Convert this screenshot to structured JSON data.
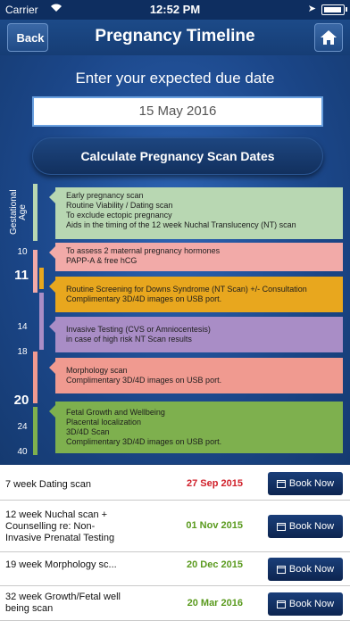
{
  "status": {
    "carrier": "Carrier",
    "time": "12:52 PM"
  },
  "nav": {
    "back_label": "Back",
    "title": "Pregnancy Timeline"
  },
  "form": {
    "prompt": "Enter your expected due date",
    "due_date": "15 May 2016",
    "calc_label": "Calculate Pregnancy Scan Dates"
  },
  "timeline": {
    "axis_label": "Gestational Age",
    "weeks": [
      "10",
      "11",
      "14",
      "18",
      "20",
      "24",
      "40"
    ],
    "boxes": [
      {
        "color": "#b8d7b2",
        "lines": [
          "Early pregnancy scan",
          "Routine Viability / Dating scan",
          "To exclude ectopic pregnancy",
          "Aids in the timing of the 12 week Nuchal Translucency (NT) scan"
        ]
      },
      {
        "color": "#f2aaa8",
        "lines": [
          "To assess 2 maternal pregnancy hormones",
          "PAPP-A & free hCG"
        ]
      },
      {
        "color": "#e8a71e",
        "lines": [
          "Routine Screening for Downs Syndrome (NT Scan) +/- Consultation",
          "Complimentary 3D/4D images on USB port."
        ]
      },
      {
        "color": "#a98dc6",
        "lines": [
          "Invasive Testing (CVS or Amniocentesis)",
          "in case of high risk NT Scan results"
        ]
      },
      {
        "color": "#f09a90",
        "lines": [
          "Morphology scan",
          "Complimentary 3D/4D images on USB port."
        ]
      },
      {
        "color": "#7eb04e",
        "lines": [
          "Fetal Growth and Wellbeing",
          "Placental localization",
          "3D/4D Scan",
          "Complimentary 3D/4D images on USB port."
        ]
      }
    ]
  },
  "bookings": [
    {
      "name": "7 week Dating scan",
      "date": "27 Sep 2015",
      "date_color": "#d0202a",
      "button": "Book Now"
    },
    {
      "name": "12 week Nuchal scan + Counselling re: Non-Invasive Prenatal Testing",
      "date": "01 Nov 2015",
      "date_color": "#5a9a1e",
      "button": "Book Now"
    },
    {
      "name": "19 week Morphology sc...",
      "date": "20 Dec 2015",
      "date_color": "#5a9a1e",
      "button": "Book Now"
    },
    {
      "name": "32 week Growth/Fetal well being scan",
      "date": "20 Mar 2016",
      "date_color": "#5a9a1e",
      "button": "Book Now"
    }
  ]
}
